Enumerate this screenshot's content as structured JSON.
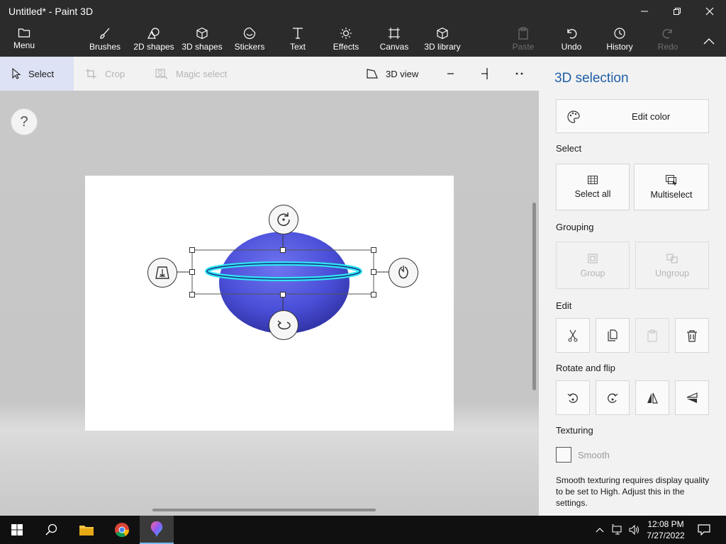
{
  "window": {
    "title": "Untitled* - Paint 3D"
  },
  "ribbon": {
    "menu": "Menu",
    "brushes": "Brushes",
    "shapes2d": "2D shapes",
    "shapes3d": "3D shapes",
    "stickers": "Stickers",
    "text": "Text",
    "effects": "Effects",
    "canvas": "Canvas",
    "library3d": "3D library",
    "paste": "Paste",
    "undo": "Undo",
    "history": "History",
    "redo": "Redo"
  },
  "subbar": {
    "select": "Select",
    "crop": "Crop",
    "magic_select": "Magic select",
    "view3d": "3D view"
  },
  "workspace": {
    "help": "?"
  },
  "panel": {
    "title": "3D selection",
    "edit_color": "Edit color",
    "select_section": "Select",
    "select_all": "Select all",
    "multiselect": "Multiselect",
    "grouping_section": "Grouping",
    "group": "Group",
    "ungroup": "Ungroup",
    "edit_section": "Edit",
    "rotate_section": "Rotate and flip",
    "texturing_section": "Texturing",
    "smooth": "Smooth",
    "note": "Smooth texturing requires display quality to be set to High. Adjust this in the settings."
  },
  "taskbar": {
    "time": "12:08 PM",
    "date": "7/27/2022"
  },
  "colors": {
    "accent": "#1f5fa8",
    "shape": "#4a4fd8",
    "ring": "#2fe6f2",
    "selected_tool": "#dde3f5"
  },
  "icons": [
    "folder-icon",
    "brush-icon",
    "shapes-2d-icon",
    "cube-icon",
    "sticker-icon",
    "text-icon",
    "effects-icon",
    "canvas-icon",
    "library-3d-icon",
    "paste-icon",
    "undo-icon",
    "history-icon",
    "redo-icon",
    "collapse-icon"
  ]
}
